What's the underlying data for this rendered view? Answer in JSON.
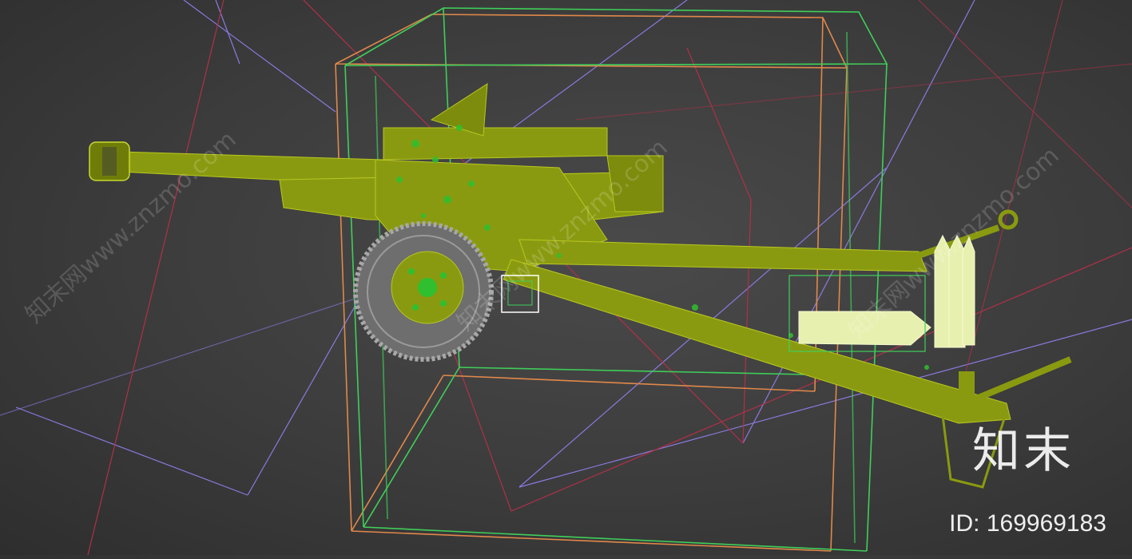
{
  "viewport": {
    "subject": "towed howitzer wireframe model",
    "colors": {
      "background": "#3c3c3c",
      "gun_fill": "#8a9a10",
      "gun_highlight": "#2fbf2f",
      "wheel": "#9a9a9a",
      "shells": "#e8f0b0",
      "bbox_orange": "#e0884a",
      "bbox_green": "#3fcf5a",
      "grid_purple": "#8a7ae0",
      "grid_red": "#b0304a"
    }
  },
  "watermark": {
    "diagonal_text": "知末网www.znzmo.com",
    "logo": "知末",
    "id_label": "ID: 169969183"
  }
}
